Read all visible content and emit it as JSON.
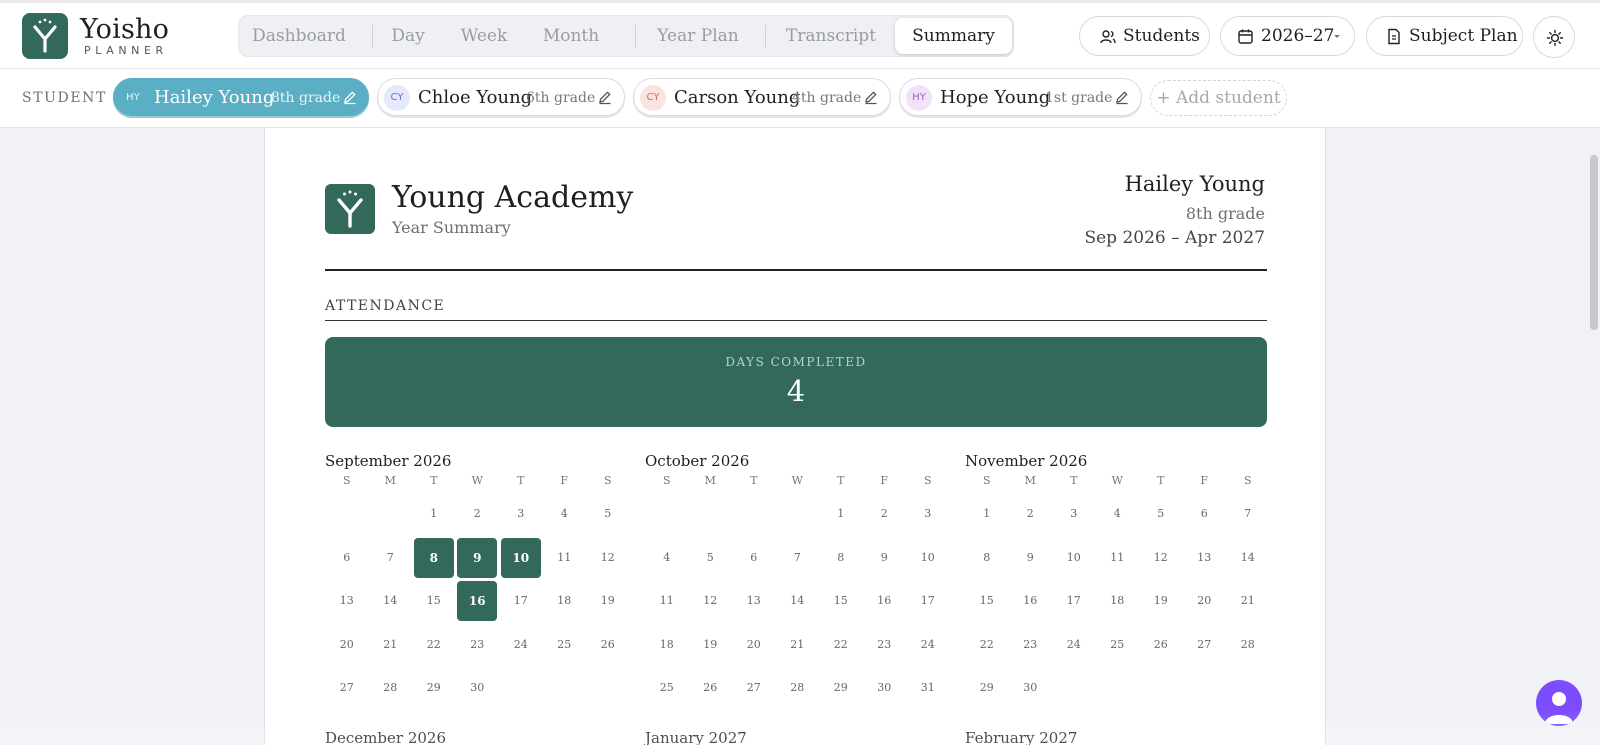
{
  "brand": {
    "name": "Yoisho",
    "sub": "PLANNER"
  },
  "nav": {
    "tabs": [
      {
        "label": "Dashboard"
      },
      {
        "label": "Day"
      },
      {
        "label": "Week"
      },
      {
        "label": "Month"
      },
      {
        "label": "Year Plan"
      },
      {
        "label": "Transcript"
      },
      {
        "label": "Summary",
        "active": true
      }
    ]
  },
  "header_buttons": {
    "students": "Students",
    "year": "2026–27",
    "subject_plan": "Subject Plan",
    "theme_icon": "sun-icon"
  },
  "student_bar": {
    "label": "STUDENT",
    "students": [
      {
        "initials": "HY",
        "name": "Hailey Young",
        "grade": "8th grade",
        "active": true
      },
      {
        "initials": "CY",
        "name": "Chloe Young",
        "grade": "6th grade"
      },
      {
        "initials": "CY",
        "name": "Carson Young",
        "grade": "4th grade"
      },
      {
        "initials": "HY",
        "name": "Hope Young",
        "grade": "1st grade"
      }
    ],
    "add_label": "+ Add student"
  },
  "summary": {
    "school": "Young Academy",
    "subtitle": "Year Summary",
    "student_name": "Hailey Young",
    "student_grade": "8th grade",
    "date_range": "Sep 2026 – Apr 2027",
    "section": "ATTENDANCE",
    "days_completed_label": "DAYS COMPLETED",
    "days_completed": "4"
  },
  "calendar": {
    "dow": [
      "S",
      "M",
      "T",
      "W",
      "T",
      "F",
      "S"
    ],
    "months": [
      {
        "name": "September 2026",
        "start": 2,
        "days": 30,
        "done": [
          8,
          9,
          10,
          16
        ]
      },
      {
        "name": "October 2026",
        "start": 4,
        "days": 31,
        "done": []
      },
      {
        "name": "November 2026",
        "start": 0,
        "days": 30,
        "done": []
      }
    ],
    "next_months": [
      "December 2026",
      "January 2027",
      "February 2027"
    ]
  },
  "colors": {
    "accent": "#33695a",
    "active_chip": "#5aafc4",
    "help": "#7c4dff"
  }
}
